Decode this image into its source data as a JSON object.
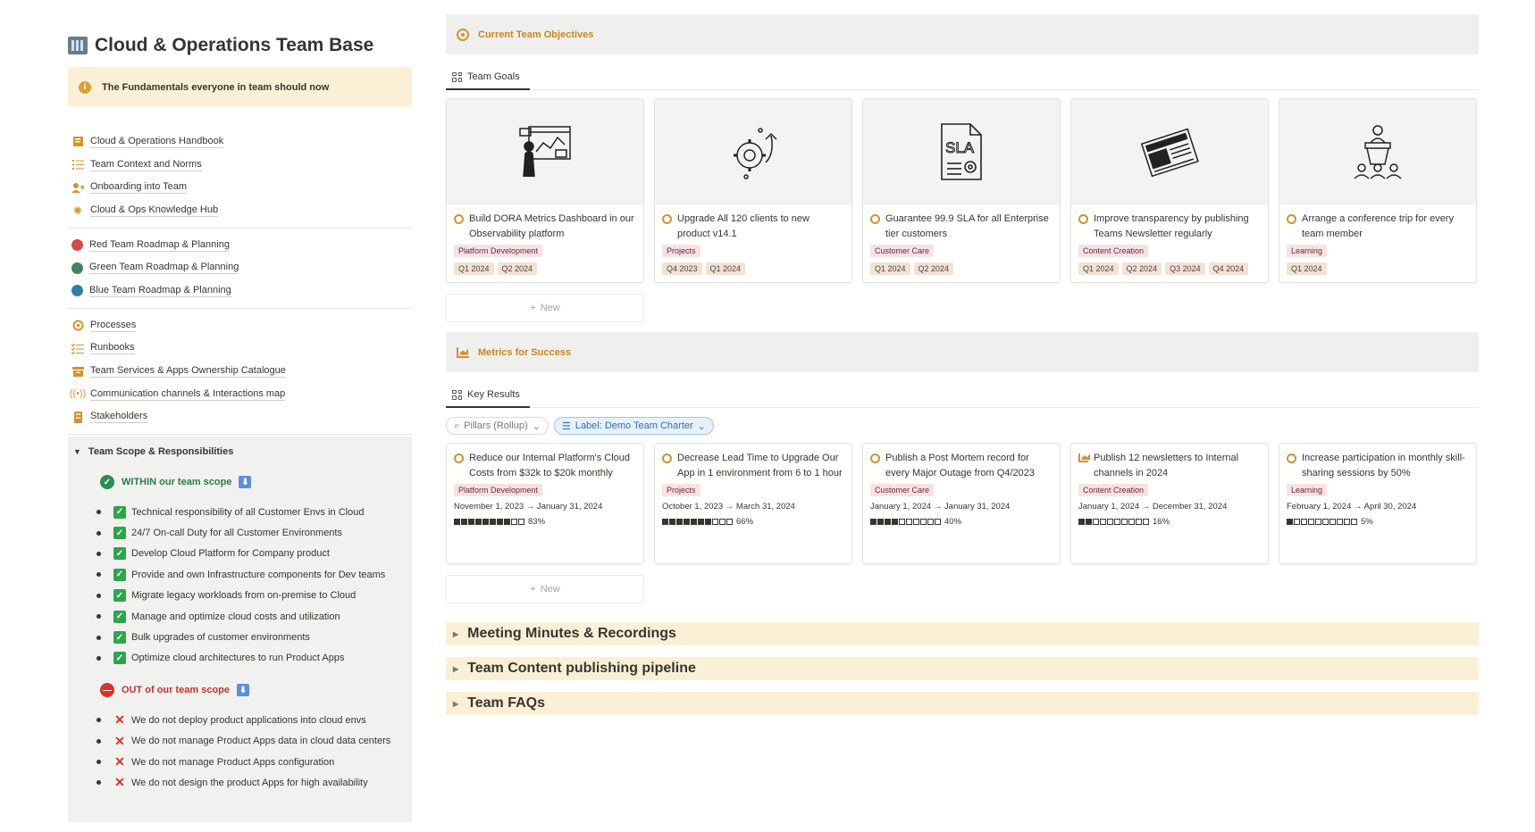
{
  "page": {
    "title": "Cloud & Operations Team Base",
    "callout": "The Fundamentals everyone in team should now"
  },
  "nav": {
    "group1": [
      {
        "label": "Cloud & Operations Handbook",
        "icon": "book-icon"
      },
      {
        "label": "Team Context and Norms",
        "icon": "list-icon"
      },
      {
        "label": "Onboarding into Team",
        "icon": "add-person-icon"
      },
      {
        "label": "Cloud & Ops Knowledge Hub",
        "icon": "sparkle-icon"
      }
    ],
    "group2": [
      {
        "label": "Red Team Roadmap & Planning",
        "color": "#d44c47"
      },
      {
        "label": "Green Team Roadmap & Planning",
        "color": "#448361"
      },
      {
        "label": "Blue Team Roadmap & Planning",
        "color": "#337ea9"
      }
    ],
    "group3": [
      {
        "label": "Processes",
        "icon": "process-icon"
      },
      {
        "label": "Runbooks",
        "icon": "checklist-icon"
      },
      {
        "label": "Team Services & Apps Ownership Catalogue",
        "icon": "archive-icon"
      },
      {
        "label": "Communication channels & Interactions map",
        "icon": "broadcast-icon"
      },
      {
        "label": "Stakeholders",
        "icon": "building-icon"
      }
    ]
  },
  "scope": {
    "title": "Team Scope & Responsibilities",
    "within_title": "WITHIN our team scope",
    "within": [
      "Technical responsibility of all Customer Envs in Cloud",
      "24/7 On-call Duty for all Customer Environments",
      "Develop Cloud Platform for Company product",
      "Provide and own Infrastructure components for Dev teams",
      "Migrate legacy workloads from on-premise to Cloud",
      "Manage and optimize cloud costs and utilization",
      "Bulk upgrades of customer environments",
      "Optimize cloud architectures to run Product Apps"
    ],
    "out_title": "OUT of our team scope",
    "out": [
      "We do not deploy product applications into cloud envs",
      "We do not manage Product Apps data in cloud data centers",
      "We do not manage Product Apps configuration",
      "We do not design the product Apps for high availability"
    ]
  },
  "objectives": {
    "banner": "Current Team Objectives",
    "tab": "Team Goals",
    "new_label": "New",
    "cards": [
      {
        "title": "Build DORA Metrics Dashboard in our Observability platform",
        "tag": "Platform Development",
        "quarters": [
          "Q1 2024",
          "Q2 2024"
        ],
        "cover": "dashboard-illustration"
      },
      {
        "title": "Upgrade All 120 clients to new product v14.1",
        "tag": "Projects",
        "quarters": [
          "Q4 2023",
          "Q1 2024"
        ],
        "cover": "upgrade-gear-illustration"
      },
      {
        "title": "Guarantee 99.9 SLA for all Enterprise tier customers",
        "tag": "Customer Care",
        "quarters": [
          "Q1 2024",
          "Q2 2024"
        ],
        "cover": "sla-document-illustration",
        "cover_text": "SLA"
      },
      {
        "title": "Improve transparency by publishing Teams Newsletter regularly",
        "tag": "Content Creation",
        "quarters": [
          "Q1 2024",
          "Q2 2024",
          "Q3 2024",
          "Q4 2024"
        ],
        "cover": "newspaper-illustration"
      },
      {
        "title": "Arrange a conference trip for every team member",
        "tag": "Learning",
        "quarters": [
          "Q1 2024"
        ],
        "cover": "conference-illustration"
      }
    ]
  },
  "metrics": {
    "banner": "Metrics for Success",
    "tab": "Key Results",
    "filter_rollup": "Pillars (Rollup)",
    "filter_label": "Label: Demo Team Charter",
    "new_label": "New",
    "cards": [
      {
        "title": "Reduce our Internal Platform's Cloud Costs from $32k to $20k monthly",
        "tag": "Platform Development",
        "dates": "November 1, 2023 → January 31, 2024",
        "progress": 0.83,
        "progress_text": "83%",
        "icon": "target-icon"
      },
      {
        "title": "Decrease Lead Time to Upgrade Our App in 1 environment from 6 to 1 hour",
        "tag": "Projects",
        "dates": "October 1, 2023 → March 31, 2024",
        "progress": 0.66,
        "progress_text": "66%",
        "icon": "target-icon"
      },
      {
        "title": "Publish a Post Mortem record for every Major Outage from Q4/2023",
        "tag": "Customer Care",
        "dates": "January 1, 2024 → January 31, 2024",
        "progress": 0.4,
        "progress_text": "40%",
        "icon": "target-icon"
      },
      {
        "title": "Publish 12 newsletters to Internal channels in 2024",
        "tag": "Content Creation",
        "dates": "January 1, 2024 → December 31, 2024",
        "progress": 0.16,
        "progress_text": "16%",
        "icon": "chart-icon"
      },
      {
        "title": "Increase participation in monthly skill-sharing sessions by 50%",
        "tag": "Learning",
        "dates": "February 1, 2024 → April 30, 2024",
        "progress": 0.05,
        "progress_text": "5%",
        "icon": "target-icon"
      }
    ]
  },
  "toggles": [
    "Meeting Minutes & Recordings",
    "Team Content publishing pipeline",
    "Team FAQs"
  ],
  "colors": {
    "accent": "#c8871f",
    "callout_bg": "#fbf0d6",
    "banner_bg": "#efefed",
    "tag_pink": "#f8e1e4",
    "tag_brown": "#f1e2d8"
  }
}
